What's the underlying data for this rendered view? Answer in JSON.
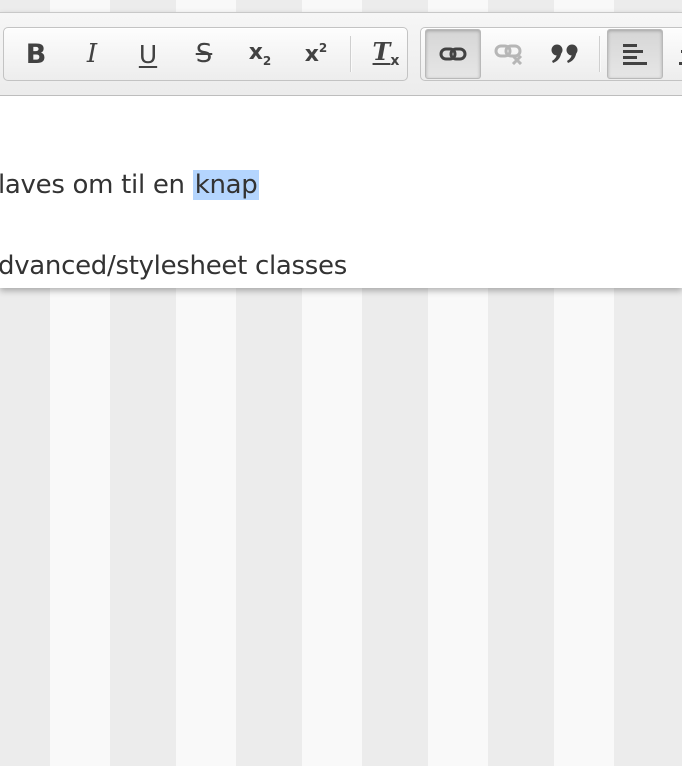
{
  "toolbar": {
    "basic_styles": [
      {
        "name": "bold",
        "icon": "bold-icon",
        "glyph": "B"
      },
      {
        "name": "italic",
        "icon": "italic-icon",
        "glyph": "I"
      },
      {
        "name": "underline",
        "icon": "underline-icon",
        "glyph": "U"
      },
      {
        "name": "strikethrough",
        "icon": "strikethrough-icon",
        "glyph": "S"
      },
      {
        "name": "subscript",
        "icon": "subscript-icon",
        "glyph": "x₂"
      },
      {
        "name": "superscript",
        "icon": "superscript-icon",
        "glyph": "x²"
      },
      {
        "name": "remove-format",
        "icon": "remove-format-icon",
        "glyph": "Tx"
      }
    ],
    "links": [
      {
        "name": "link",
        "icon": "link-icon",
        "active": true
      },
      {
        "name": "unlink",
        "icon": "unlink-icon",
        "disabled": true
      },
      {
        "name": "blockquote",
        "icon": "blockquote-icon"
      },
      {
        "name": "align-left",
        "icon": "align-left-icon",
        "active": true
      },
      {
        "name": "align-center",
        "icon": "align-center-icon"
      }
    ]
  },
  "content": {
    "line1_before": "laves om til en ",
    "line1_selected": "knap",
    "line2": "dvanced/stylesheet classes"
  },
  "colors": {
    "selection": "#b4d5fe",
    "text": "#333333",
    "icon": "#424242"
  }
}
